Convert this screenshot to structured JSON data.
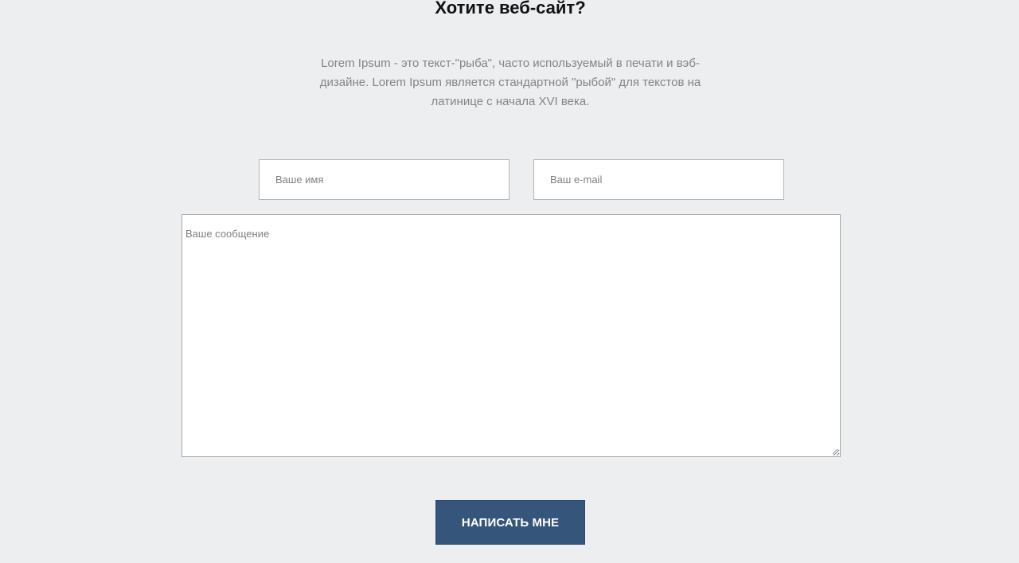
{
  "contact": {
    "title": "Хотите веб-сайт?",
    "description": "Lorem Ipsum - это текст-\"рыба\", часто используемый в печати и вэб-дизайне. Lorem Ipsum является стандартной \"рыбой\" для текстов на латинице с начала XVI века.",
    "name_placeholder": "Ваше имя",
    "email_placeholder": "Ваш e-mail",
    "message_placeholder": "Ваше сообщение",
    "submit_label": "НАПИСАТЬ МНЕ",
    "resize_handle_icon": "resize-handle-icon"
  },
  "colors": {
    "background": "#edeef0",
    "button": "#35557b",
    "button_text": "#ffffff",
    "description_text": "#858585"
  }
}
